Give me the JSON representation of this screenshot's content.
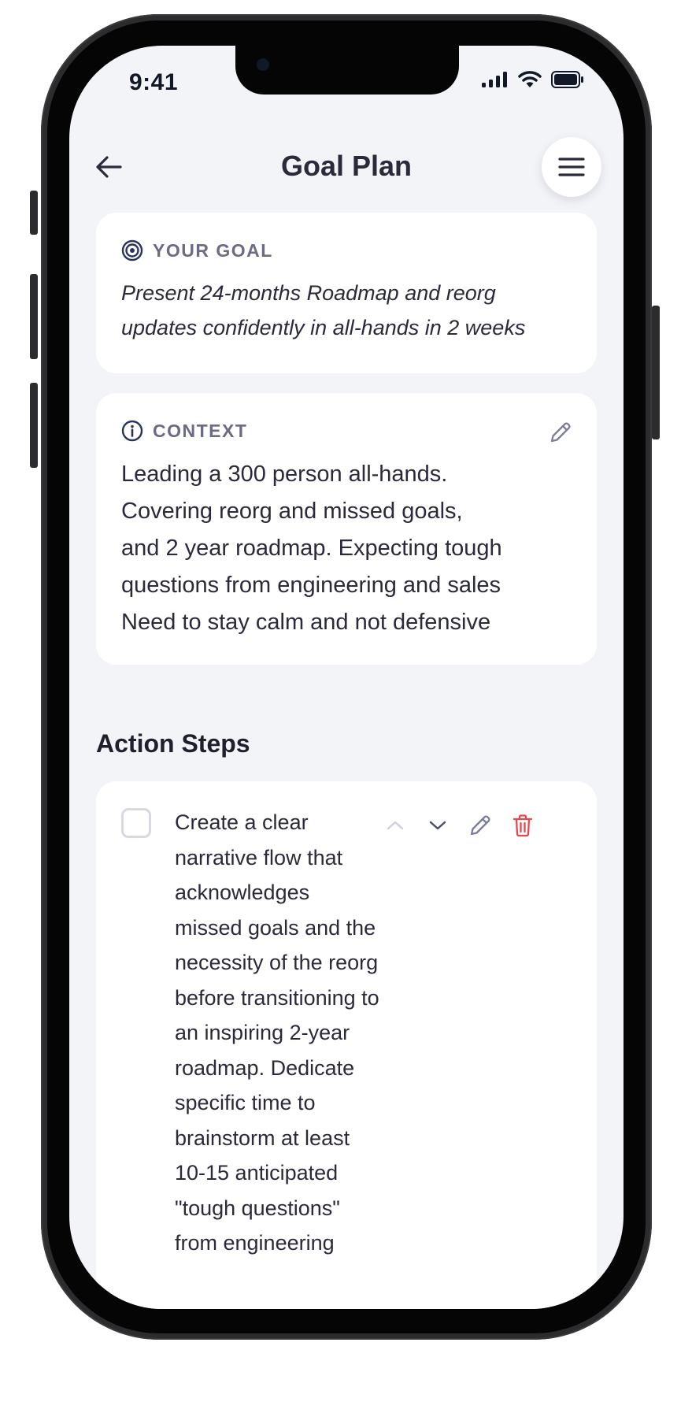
{
  "status_bar": {
    "time": "9:41"
  },
  "header": {
    "title": "Goal Plan"
  },
  "goal_card": {
    "label": "YOUR GOAL",
    "text": "Present 24-months Roadmap and reorg updates confidently in all-hands in 2 weeks"
  },
  "context_card": {
    "label": "CONTEXT",
    "text": "Leading a 300 person all-hands.\nCovering reorg and missed goals,\nand 2 year roadmap. Expecting tough\nquestions from engineering and sales\nNeed to stay calm and not defensive"
  },
  "action_steps": {
    "title": "Action Steps",
    "items": [
      {
        "text": "Create a clear narrative flow that acknowledges missed goals and the necessity of the reorg before transitioning to an inspiring 2-year roadmap. Dedicate specific time to brainstorm at least 10-15 anticipated \"tough questions\" from engineering",
        "checked": false
      }
    ]
  },
  "colors": {
    "background": "#f3f4f8",
    "card": "#ffffff",
    "text": "#2a2a3a",
    "label": "#6b6b85",
    "delete": "#e5484d"
  }
}
